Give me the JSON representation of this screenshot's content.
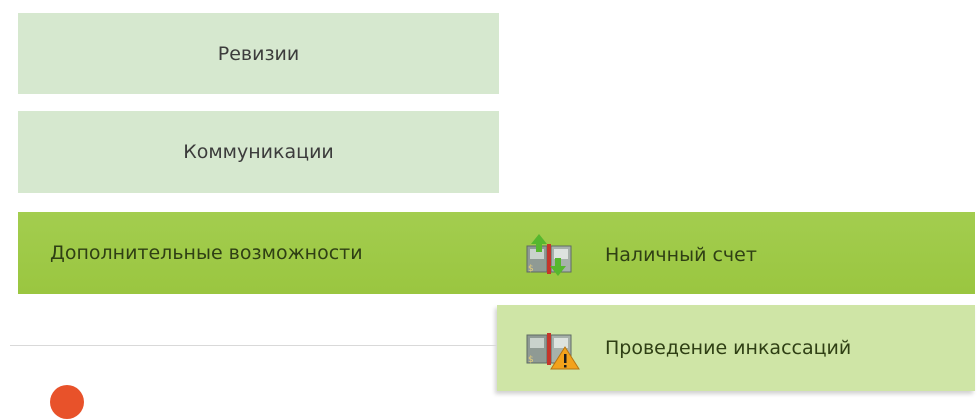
{
  "menu": {
    "revisions_label": "Ревизии",
    "communications_label": "Коммуникации",
    "extra_label": "Дополнительные возможности"
  },
  "submenu": {
    "items": [
      {
        "label": "Наличный счет",
        "icon": "cash-account-icon"
      },
      {
        "label": "Проведение инкассаций",
        "icon": "collection-warning-icon"
      }
    ]
  },
  "colors": {
    "menu_bg": "#d6e8cf",
    "active_green": "#a3cd4f",
    "submenu_hover": "#cfe5a6",
    "warning": "#f3a21b"
  }
}
